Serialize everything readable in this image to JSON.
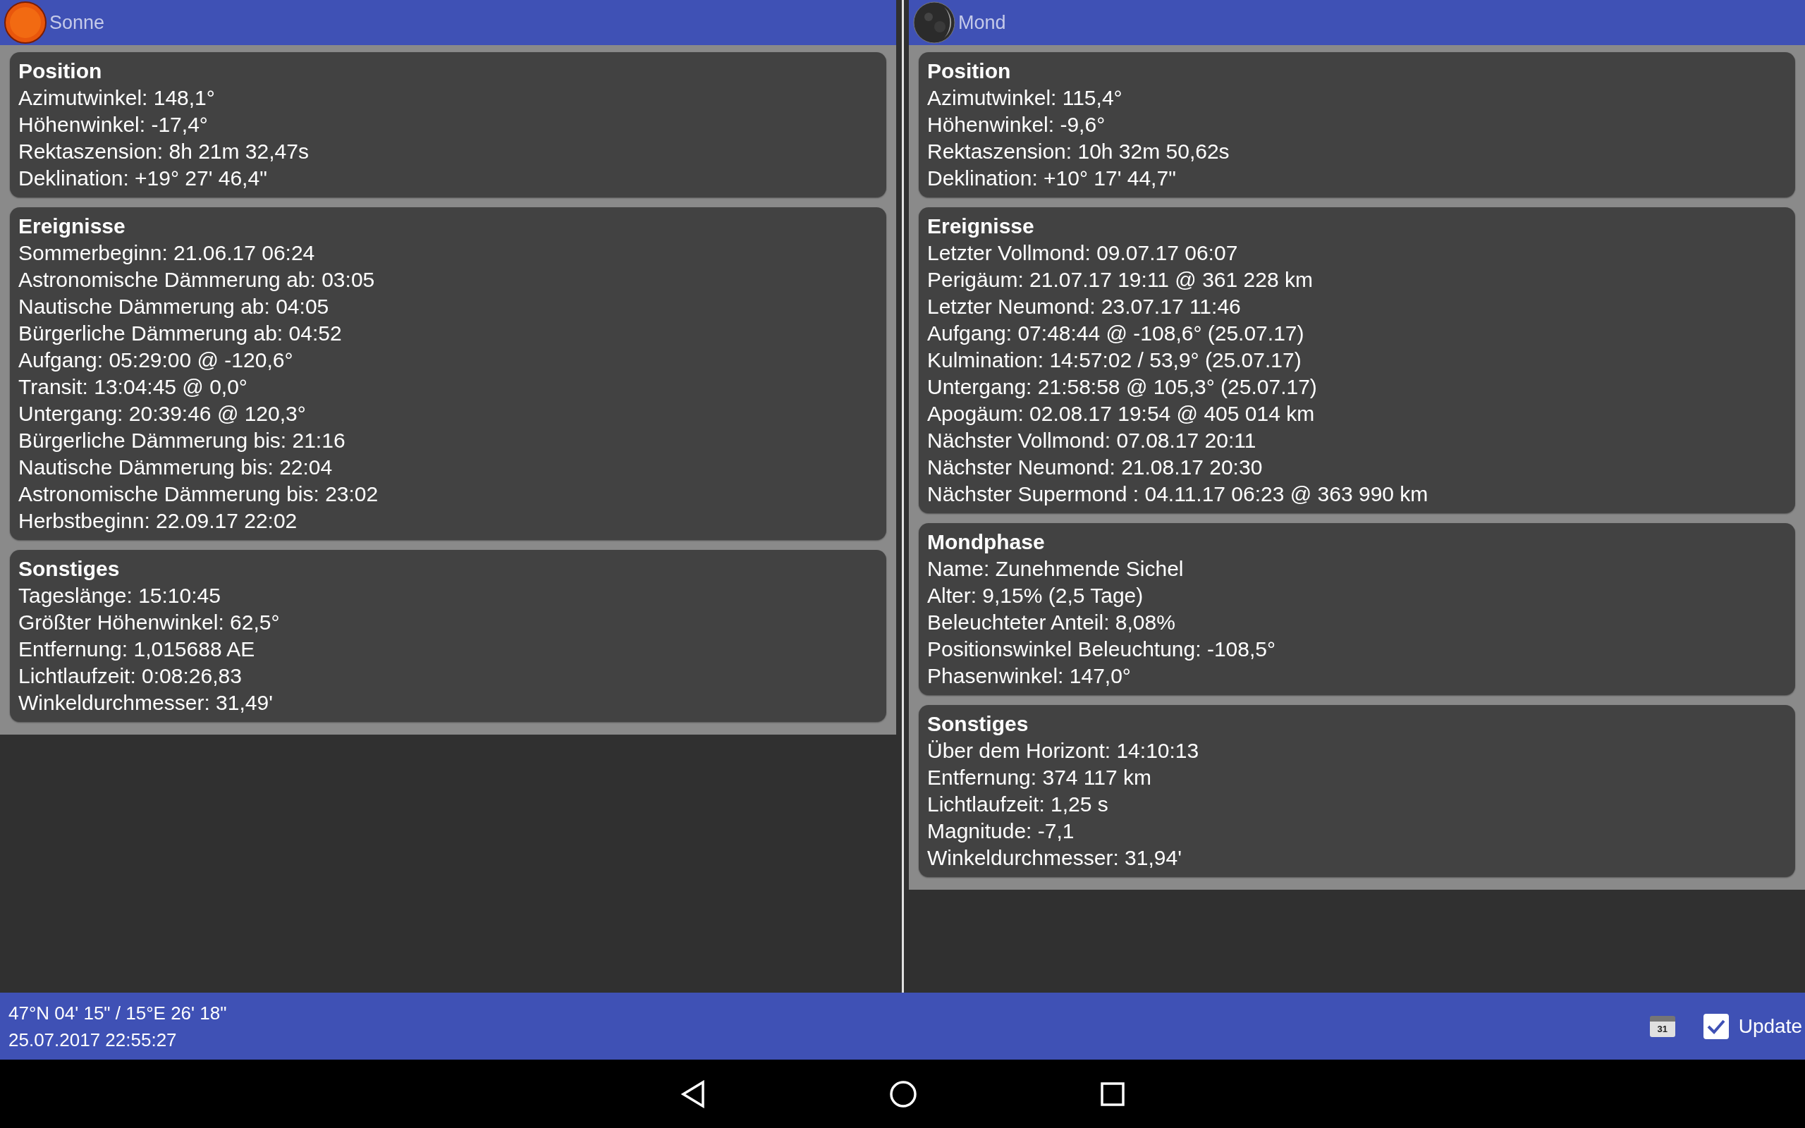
{
  "panels": [
    {
      "title": "Sonne",
      "kind": "sun",
      "sections": [
        {
          "heading": "Position",
          "lines": [
            "Azimutwinkel: 148,1°",
            "Höhenwinkel: -17,4°",
            "Rektaszension: 8h 21m 32,47s",
            "Deklination: +19° 27' 46,4\""
          ]
        },
        {
          "heading": "Ereignisse",
          "lines": [
            "Sommerbeginn: 21.06.17 06:24",
            "Astronomische Dämmerung ab: 03:05",
            "Nautische Dämmerung ab: 04:05",
            "Bürgerliche Dämmerung ab: 04:52",
            "Aufgang: 05:29:00 @ -120,6°",
            "Transit: 13:04:45 @ 0,0°",
            "Untergang: 20:39:46 @ 120,3°",
            "Bürgerliche Dämmerung bis: 21:16",
            "Nautische Dämmerung bis: 22:04",
            "Astronomische Dämmerung bis: 23:02",
            "Herbstbeginn: 22.09.17 22:02"
          ]
        },
        {
          "heading": "Sonstiges",
          "lines": [
            "Tageslänge: 15:10:45",
            "Größter Höhenwinkel: 62,5°",
            "Entfernung: 1,015688 AE",
            "Lichtlaufzeit: 0:08:26,83",
            "Winkeldurchmesser: 31,49'"
          ]
        }
      ]
    },
    {
      "title": "Mond",
      "kind": "moon",
      "sections": [
        {
          "heading": "Position",
          "lines": [
            "Azimutwinkel: 115,4°",
            "Höhenwinkel: -9,6°",
            "Rektaszension: 10h 32m 50,62s",
            "Deklination: +10° 17' 44,7\""
          ]
        },
        {
          "heading": "Ereignisse",
          "lines": [
            "Letzter Vollmond: 09.07.17 06:07",
            "Perigäum: 21.07.17 19:11 @ 361 228 km",
            "Letzter Neumond: 23.07.17 11:46",
            "Aufgang: 07:48:44 @ -108,6° (25.07.17)",
            "Kulmination: 14:57:02 / 53,9° (25.07.17)",
            "Untergang: 21:58:58 @ 105,3° (25.07.17)",
            "Apogäum: 02.08.17 19:54 @ 405 014 km",
            "Nächster Vollmond: 07.08.17 20:11",
            "Nächster Neumond: 21.08.17 20:30",
            "Nächster Supermond : 04.11.17 06:23 @ 363 990 km"
          ]
        },
        {
          "heading": "Mondphase",
          "lines": [
            "Name: Zunehmende Sichel",
            "Alter: 9,15% (2,5 Tage)",
            "Beleuchteter Anteil: 8,08%",
            "Positionswinkel Beleuchtung: -108,5°",
            "Phasenwinkel: 147,0°"
          ]
        },
        {
          "heading": "Sonstiges",
          "lines": [
            "Über dem Horizont: 14:10:13",
            "Entfernung: 374 117 km",
            "Lichtlaufzeit: 1,25 s",
            "Magnitude: -7,1",
            "Winkeldurchmesser: 31,94'"
          ]
        }
      ]
    }
  ],
  "status_bar": {
    "coordinates": "47°N 04' 15\" / 15°E 26' 18\"",
    "datetime": "25.07.2017 22:55:27",
    "calendar_day": "31",
    "update": {
      "label": "Update",
      "checked": true
    }
  }
}
